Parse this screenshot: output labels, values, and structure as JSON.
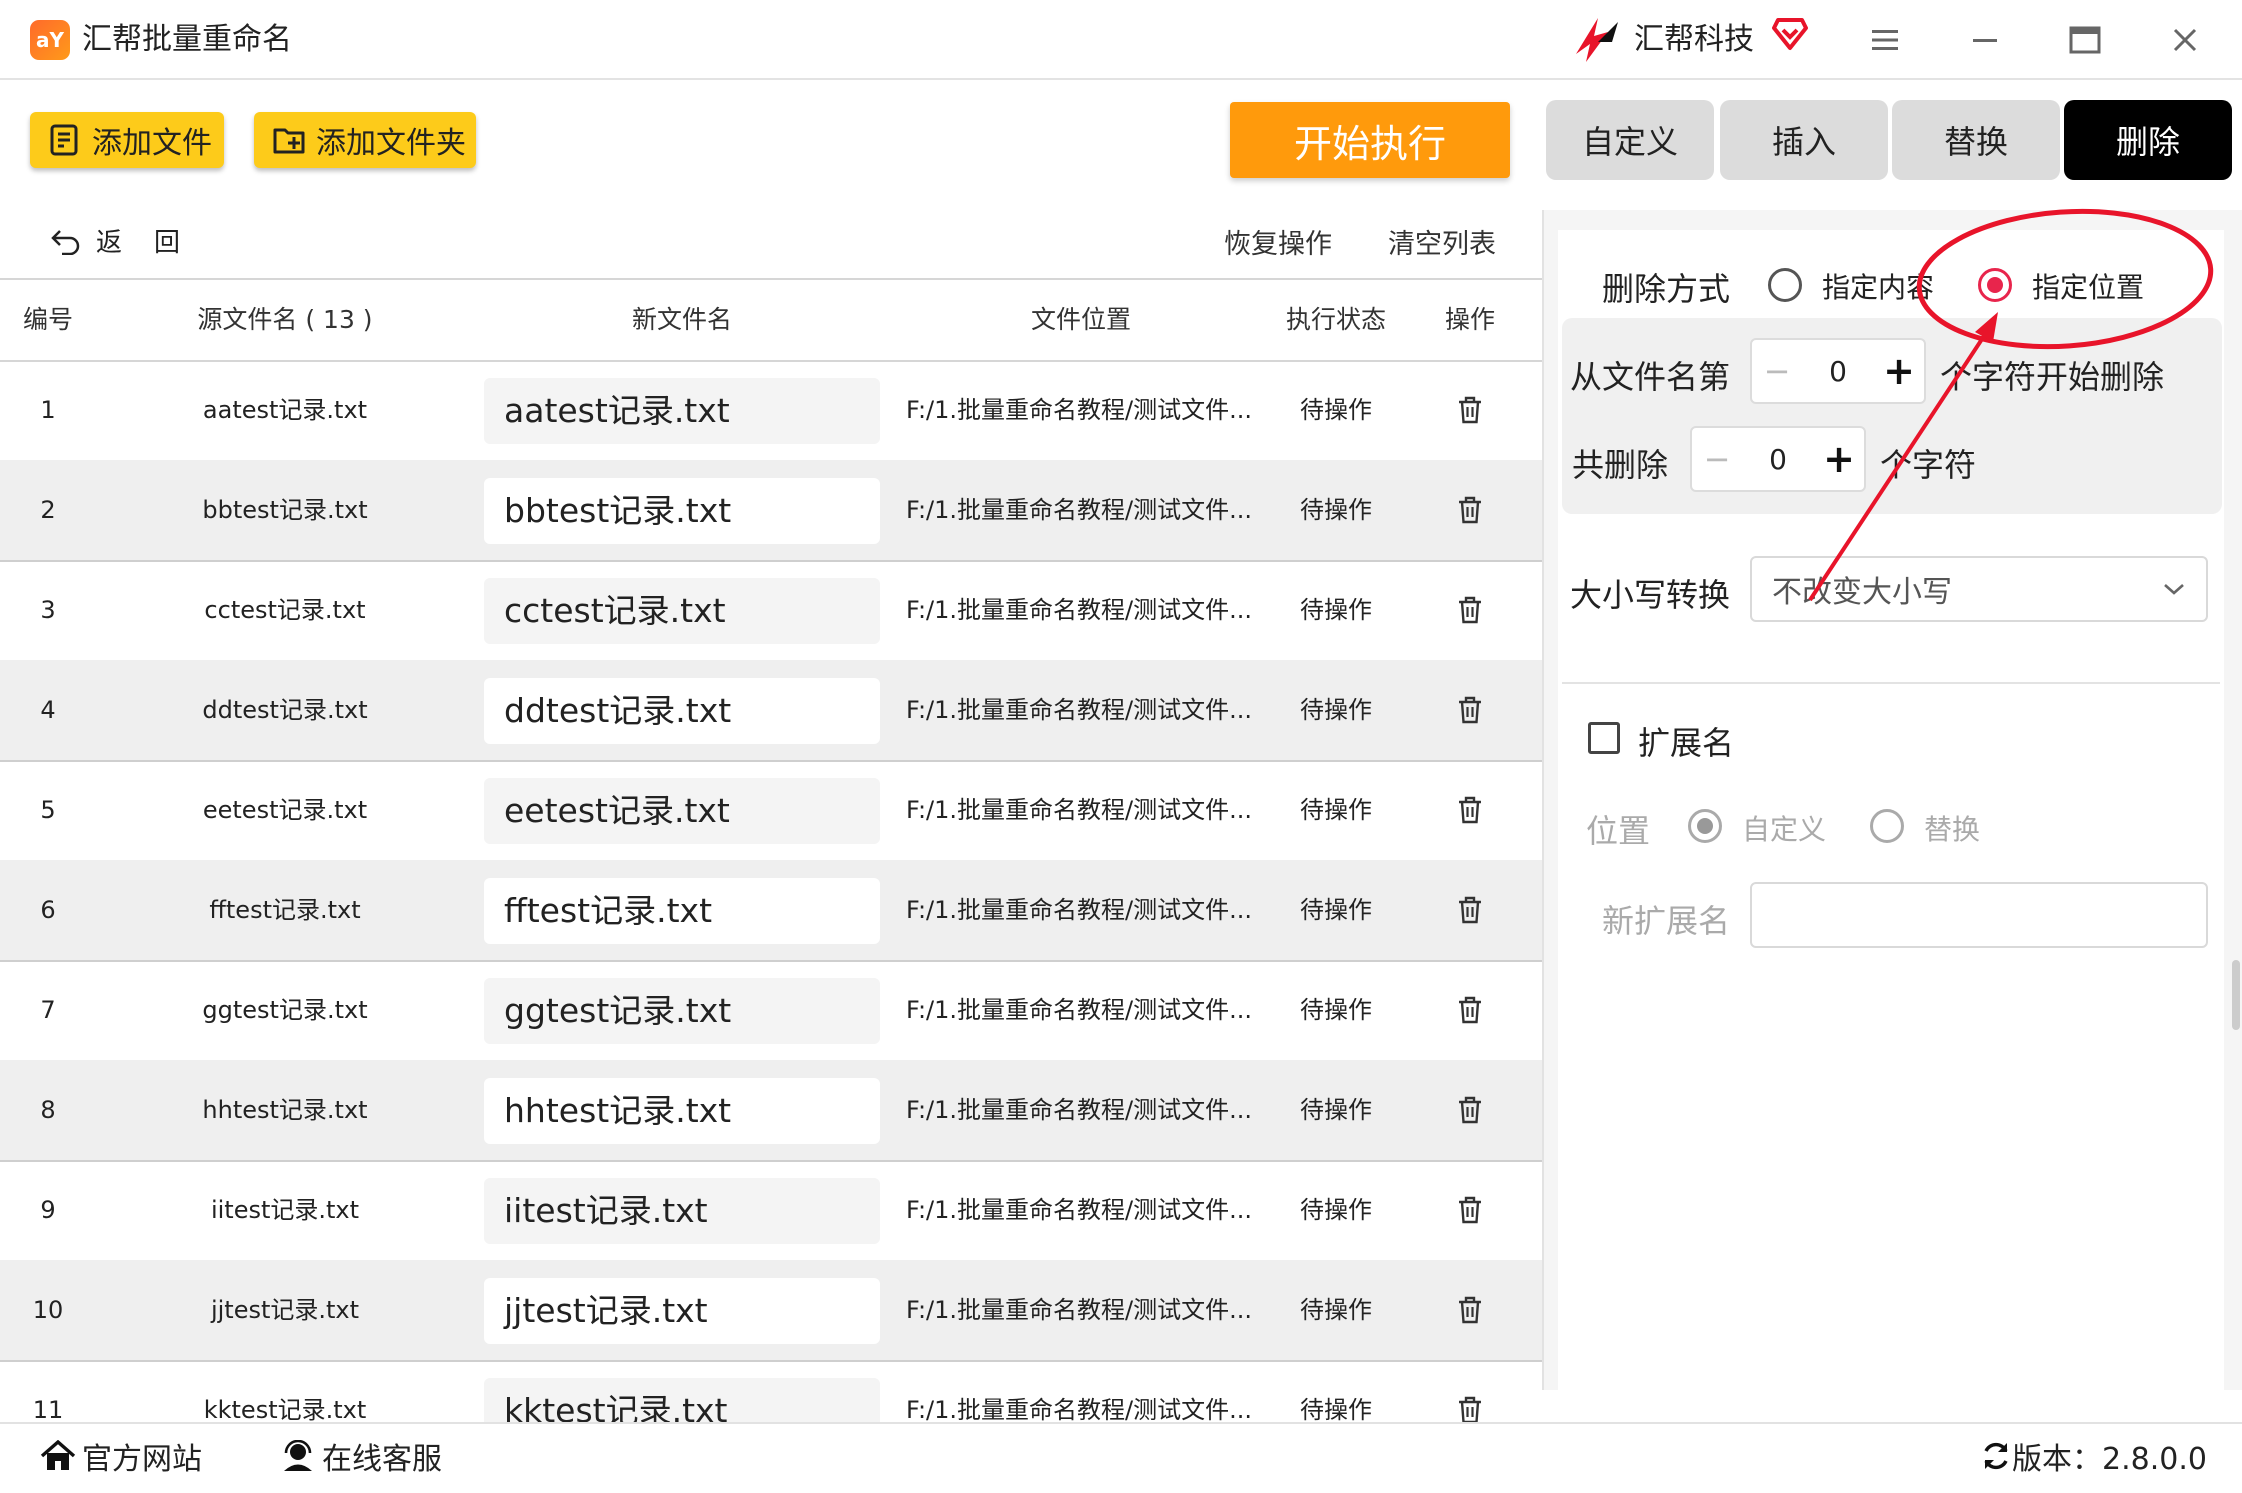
{
  "app": {
    "title": "汇帮批量重命名",
    "logo_text": "aY",
    "brand_name": "汇帮科技"
  },
  "toolbar": {
    "add_file_label": "添加文件",
    "add_folder_label": "添加文件夹",
    "start_label": "开始执行",
    "back_label": "返回",
    "restore_label": "恢复操作",
    "clear_label": "清空列表"
  },
  "tabs": [
    {
      "label": "自定义",
      "active": false
    },
    {
      "label": "插入",
      "active": false
    },
    {
      "label": "替换",
      "active": false
    },
    {
      "label": "删除",
      "active": true
    }
  ],
  "table": {
    "headers": {
      "no": "编号",
      "source": "源文件名 ( 13 )",
      "new_name": "新文件名",
      "path": "文件位置",
      "status": "执行状态",
      "op": "操作"
    },
    "rows": [
      {
        "no": "1",
        "source": "aatest记录.txt",
        "new_name": "aatest记录.txt",
        "path": "F:/1.批量重命名教程/测试文件...",
        "status": "待操作"
      },
      {
        "no": "2",
        "source": "bbtest记录.txt",
        "new_name": "bbtest记录.txt",
        "path": "F:/1.批量重命名教程/测试文件...",
        "status": "待操作"
      },
      {
        "no": "3",
        "source": "cctest记录.txt",
        "new_name": "cctest记录.txt",
        "path": "F:/1.批量重命名教程/测试文件...",
        "status": "待操作"
      },
      {
        "no": "4",
        "source": "ddtest记录.txt",
        "new_name": "ddtest记录.txt",
        "path": "F:/1.批量重命名教程/测试文件...",
        "status": "待操作"
      },
      {
        "no": "5",
        "source": "eetest记录.txt",
        "new_name": "eetest记录.txt",
        "path": "F:/1.批量重命名教程/测试文件...",
        "status": "待操作"
      },
      {
        "no": "6",
        "source": "fftest记录.txt",
        "new_name": "fftest记录.txt",
        "path": "F:/1.批量重命名教程/测试文件...",
        "status": "待操作"
      },
      {
        "no": "7",
        "source": "ggtest记录.txt",
        "new_name": "ggtest记录.txt",
        "path": "F:/1.批量重命名教程/测试文件...",
        "status": "待操作"
      },
      {
        "no": "8",
        "source": "hhtest记录.txt",
        "new_name": "hhtest记录.txt",
        "path": "F:/1.批量重命名教程/测试文件...",
        "status": "待操作"
      },
      {
        "no": "9",
        "source": "iitest记录.txt",
        "new_name": "iitest记录.txt",
        "path": "F:/1.批量重命名教程/测试文件...",
        "status": "待操作"
      },
      {
        "no": "10",
        "source": "jjtest记录.txt",
        "new_name": "jjtest记录.txt",
        "path": "F:/1.批量重命名教程/测试文件...",
        "status": "待操作"
      },
      {
        "no": "11",
        "source": "kktest记录.txt",
        "new_name": "kktest记录.txt",
        "path": "F:/1.批量重命名教程/测试文件...",
        "status": "待操作"
      }
    ]
  },
  "panel": {
    "delete_mode_label": "删除方式",
    "mode_content_label": "指定内容",
    "mode_position_label": "指定位置",
    "mode_selected": "指定位置",
    "from_label": "从文件名第",
    "from_value": "0",
    "from_suffix": "个字符开始删除",
    "count_label": "共删除",
    "count_value": "0",
    "count_suffix": "个字符",
    "case_label": "大小写转换",
    "case_value": "不改变大小写",
    "ext_label": "扩展名",
    "ext_checked": false,
    "pos_label": "位置",
    "pos_custom_label": "自定义",
    "pos_replace_label": "替换",
    "new_ext_label": "新扩展名",
    "new_ext_value": ""
  },
  "footer": {
    "website_label": "官方网站",
    "support_label": "在线客服",
    "version_label": "版本：2.8.0.0"
  },
  "colors": {
    "accent_yellow": "#fdcb1a",
    "start_orange": "#ff9a0c",
    "radio_red": "#e8254c",
    "annotation_red": "#e8142a"
  }
}
